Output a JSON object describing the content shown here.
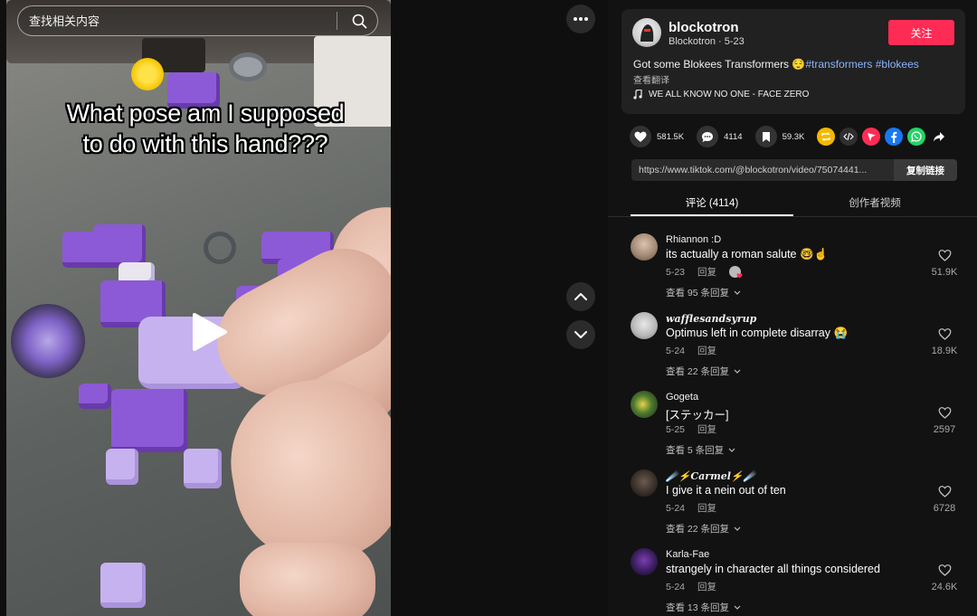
{
  "search": {
    "placeholder": "查找相关内容"
  },
  "video": {
    "caption": "What pose am I supposed\nto do with this hand???"
  },
  "author": {
    "username": "blockotron",
    "display_name": "Blockotron",
    "date": "5-23",
    "follow_label": "关注"
  },
  "post": {
    "text": "Got some Blokees Transformers 😌",
    "hashtags": [
      "#transformers",
      "#blokees"
    ],
    "translate_label": "查看翻译",
    "music": "WE ALL KNOW NO ONE - FACE ZERO"
  },
  "stats": {
    "likes": "581.5K",
    "comments": "4114",
    "saves": "59.3K"
  },
  "share": {
    "url": "https://www.tiktok.com/@blockotron/video/75074441...",
    "copy_label": "复制链接"
  },
  "tabs": {
    "comments": "评论 (4114)",
    "creator_videos": "创作者视频"
  },
  "comments": [
    {
      "user": "Rhiannon :D",
      "text": "its actually a roman salute 🤓☝️",
      "date": "5-23",
      "reply_label": "回复",
      "replies": "查看 95 条回复",
      "likes": "51.9K"
    },
    {
      "user": "𝒘𝒂𝒇𝒇𝒍𝒆𝒔𝒂𝒏𝒅𝒔𝒚𝒓𝒖𝒑",
      "text": "Optimus left in complete disarray 😭",
      "date": "5-24",
      "reply_label": "回复",
      "replies": "查看 22 条回复",
      "likes": "18.9K"
    },
    {
      "user": "Gogeta",
      "text": "[ステッカー]",
      "date": "5-25",
      "reply_label": "回复",
      "replies": "查看 5 条回复",
      "likes": "2597"
    },
    {
      "user": "☄️⚡𝑪𝒂𝒓𝒎𝒆𝒍⚡☄️",
      "text": "I give it a nein out of ten",
      "date": "5-24",
      "reply_label": "回复",
      "replies": "查看 22 条回复",
      "likes": "6728"
    },
    {
      "user": "Karla-Fae",
      "text": "strangely in character all things considered",
      "date": "5-24",
      "reply_label": "回复",
      "replies": "查看 13 条回复",
      "likes": "24.6K"
    }
  ],
  "colors": {
    "accent": "#fe2c55",
    "hashtag": "#8bb4ff",
    "panel": "#212121",
    "background": "#121212"
  }
}
